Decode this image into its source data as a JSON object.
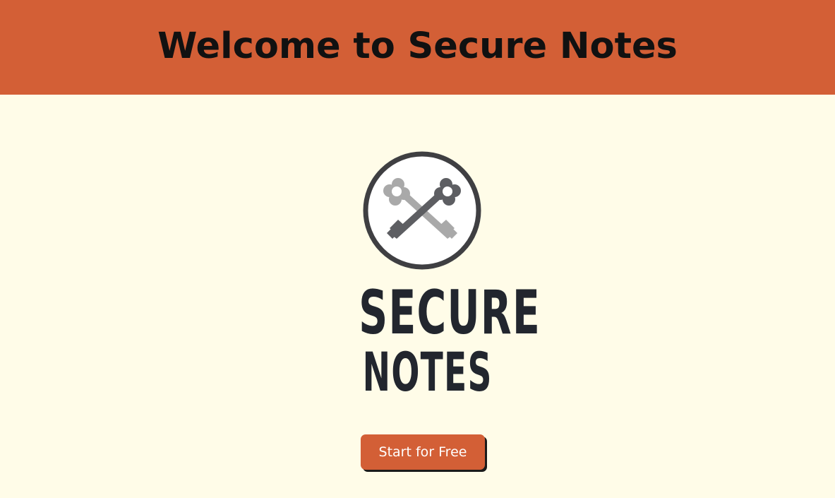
{
  "header": {
    "title": "Welcome to Secure Notes"
  },
  "logo": {
    "line1": "SECURE",
    "line2": "NOTES",
    "icon": "crossed-keys-icon"
  },
  "cta": {
    "label": "Start for Free"
  },
  "colors": {
    "accent": "#D35F36",
    "background": "#FFFCE8",
    "wordmark": "#22262E"
  }
}
